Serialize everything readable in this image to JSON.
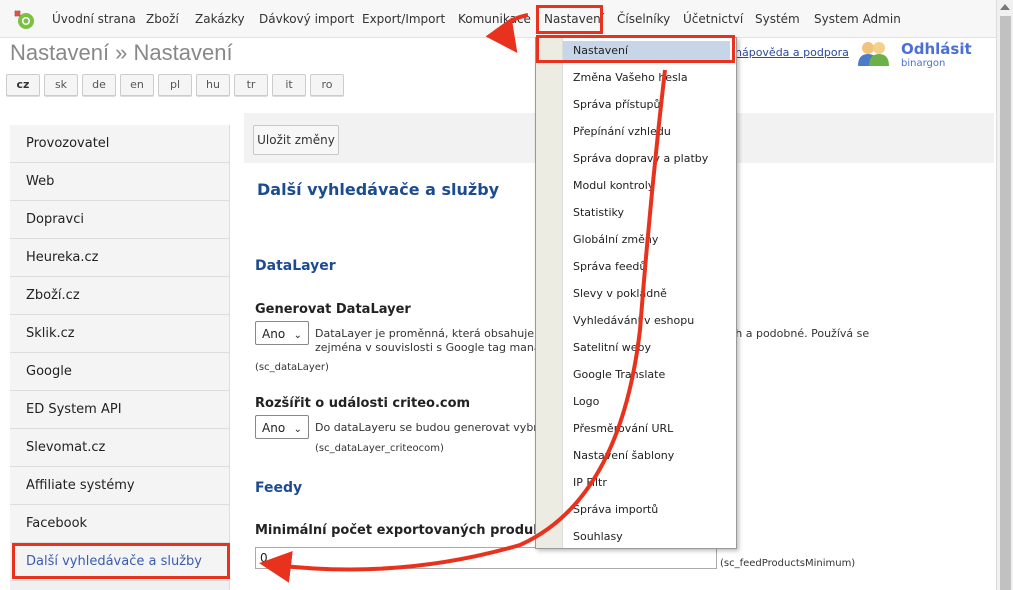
{
  "nav": {
    "items": [
      "Úvodní strana",
      "Zboží",
      "Zakázky",
      "Dávkový import",
      "Export/Import",
      "Komunikace",
      "Nastavení",
      "Číselníky",
      "Účetnictví",
      "Systém",
      "System Admin"
    ]
  },
  "header": {
    "title": "Nastavení » Nastavení",
    "help": "nápověda a podpora",
    "logout": "Odhlásit",
    "user": "binargon"
  },
  "languages": [
    "cz",
    "sk",
    "de",
    "en",
    "pl",
    "hu",
    "tr",
    "it",
    "ro"
  ],
  "sidebar": {
    "items": [
      "Provozovatel",
      "Web",
      "Dopravci",
      "Heureka.cz",
      "Zboží.cz",
      "Sklik.cz",
      "Google",
      "ED System API",
      "Slevomat.cz",
      "Affiliate systémy",
      "Facebook",
      "Další vyhledávače a služby"
    ]
  },
  "toolbar": {
    "save": "Uložit změny"
  },
  "main": {
    "title": "Další vyhledávače a služby",
    "datalayer": {
      "heading": "DataLayer",
      "gen_label": "Generovat DataLayer",
      "gen_value": "Ano",
      "gen_desc1": "DataLayer je proměnná, která obsahuje informace o zobrazených produktech a podobné. Používá se",
      "gen_desc2": "zejména v souvislosti s Google tag managerem pro měření stran.",
      "gen_code": "(sc_dataLayer)",
      "criteo_label": "Rozšířit o události criteo.com",
      "criteo_value": "Ano",
      "criteo_desc": "Do dataLayeru se budou generovat vybrané události",
      "criteo_code": "(sc_dataLayer_criteocom)"
    },
    "feedy": {
      "heading": "Feedy",
      "min_label": "Minimální počet exportovaných produktů pro vygenerování feedu",
      "min_value": "0",
      "min_code": "(sc_feedProductsMinimum)"
    }
  },
  "dropdown": {
    "items": [
      "Nastavení",
      "Změna Vašeho hesla",
      "Správa přístupů",
      "Přepínání vzhledu",
      "Správa dopravy a platby",
      "Modul kontroly",
      "Statistiky",
      "Globální změny",
      "Správa feedů",
      "Slevy v pokladně",
      "Vyhledávání v eshopu",
      "Satelitní weby",
      "Google Translate",
      "Logo",
      "Přesměrování URL",
      "Nastavení šablony",
      "IP Filtr",
      "Správa importů",
      "Souhlasy"
    ]
  },
  "colors": {
    "highlight": "#e8321e",
    "accent": "#1d4b8f",
    "link": "#4b6fd6"
  }
}
